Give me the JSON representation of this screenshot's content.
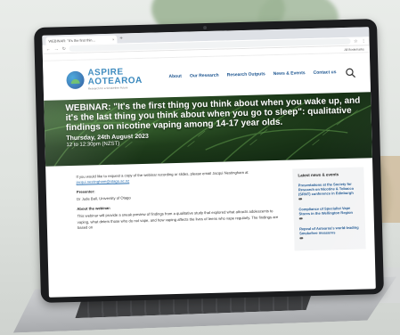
{
  "browser": {
    "tab_title": "WEBINAR: \"It's the first thin...",
    "tab_close": "×",
    "new_tab": "+",
    "url": "",
    "bookmarks_label": "All Bookmarks"
  },
  "site": {
    "logo_line1": "ASPIRE",
    "logo_line2": "AOTEAROA",
    "tagline": "Research for a Smokefree Future",
    "nav": [
      {
        "label": "About",
        "sub": ""
      },
      {
        "label": "Our Research",
        "sub": ""
      },
      {
        "label": "Research Outputs",
        "sub": ""
      },
      {
        "label": "News & Events",
        "sub": ""
      },
      {
        "label": "Contact us",
        "sub": ""
      }
    ]
  },
  "hero": {
    "title": "WEBINAR: \"It's the first thing you think about when you wake up, and it's the last thing you think about when you go to sleep\": qualitative findings on nicotine vaping among 14-17 year olds.",
    "date": "Thursday, 24th August 2023",
    "time": "12 to 12:30pm (NZST)"
  },
  "breadcrumb": "",
  "article": {
    "intro": "If you would like to request a copy of the webinar recording or slides, please email Jacqui Nestingham at",
    "email": "jacqui.nestingham@otago.ac.nz",
    "presenter_label": "Presenter:",
    "presenter": "Dr Jude Ball, University of Otago",
    "about_label": "About the webinar:",
    "about": "This webinar will provide a sneak preview of findings from a qualitative study that explored what attracts adolescents to vaping, what deters those who do not vape, and how vaping affects the lives of teens who vape regularly. The findings are based on"
  },
  "sidebar": {
    "title": "Latest news & events",
    "items": [
      {
        "title": "Presentations at the Society for Research on Nicotine & Tobacco (SRNT) conference in Edinburgh",
        "badge": "",
        "date": ""
      },
      {
        "title": "Compliance of Specialist Vape Stores in the Wellington Region",
        "badge": "",
        "date": ""
      },
      {
        "title": "Repeal of Aotearoa's world-leading Smokefree measures",
        "badge": "",
        "date": ""
      }
    ]
  },
  "colors": {
    "brand_blue": "#2a7fb8",
    "nav_blue": "#1c5590",
    "hero_green": "#1f3d1b"
  }
}
